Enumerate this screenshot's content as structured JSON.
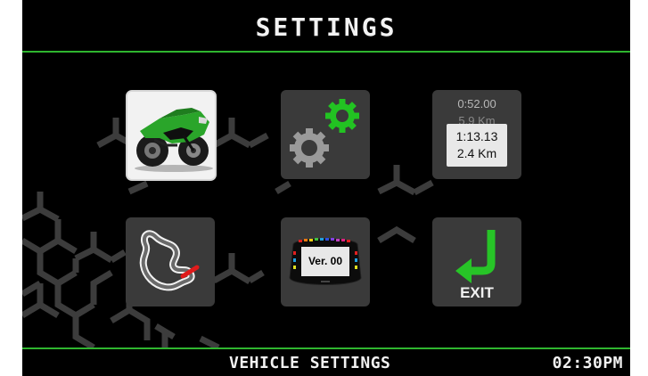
{
  "header": {
    "title": "SETTINGS"
  },
  "tiles": {
    "vehicle": {
      "icon": "motorcycle-icon"
    },
    "system": {
      "icon": "gears-icon"
    },
    "laps": {
      "row1_time": "0:52.00",
      "row1_dist": "5.9 Km",
      "row2_time": "1:13.13",
      "row2_dist": "2.4 Km"
    },
    "track": {
      "icon": "track-map-icon"
    },
    "firmware": {
      "version": "Ver. 00",
      "icon": "dash-device-icon"
    },
    "exit": {
      "label": "EXIT",
      "icon": "return-arrow-icon"
    }
  },
  "footer": {
    "label": "VEHICLE SETTINGS",
    "clock": "02:30PM"
  },
  "colors": {
    "accent_green": "#2fb52f",
    "tile": "#3a3a3a",
    "background": "#000000"
  }
}
